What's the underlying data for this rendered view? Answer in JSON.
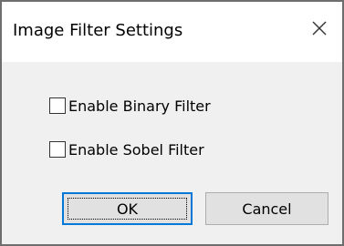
{
  "window": {
    "title": "Image Filter Settings",
    "close_icon": "close-x-icon"
  },
  "options": [
    {
      "label": "Enable Binary Filter",
      "checked": false
    },
    {
      "label": "Enable Sobel Filter",
      "checked": false
    }
  ],
  "buttons": {
    "ok_label": "OK",
    "cancel_label": "Cancel"
  },
  "colors": {
    "focus_accent": "#0078d7",
    "dialog_background": "#f0f0f0",
    "titlebar_background": "#ffffff"
  }
}
